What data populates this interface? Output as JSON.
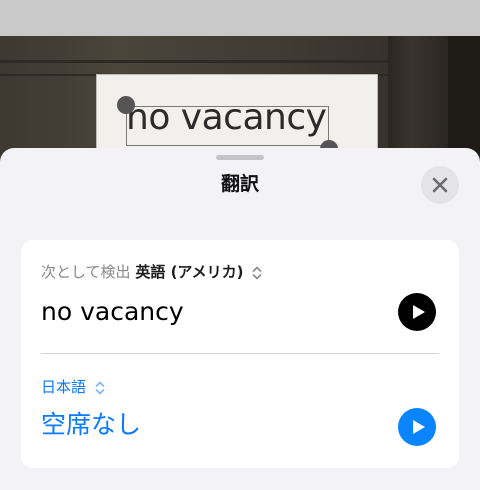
{
  "camera": {
    "detected_text": "no vacancy"
  },
  "sheet": {
    "title": "翻訳",
    "close_icon": "close-icon"
  },
  "source": {
    "prefix": "次として検出",
    "language": "英語 (アメリカ)",
    "text": "no vacancy",
    "play_icon": "play-icon"
  },
  "target": {
    "language": "日本語",
    "text": "空席なし",
    "play_icon": "play-icon"
  },
  "colors": {
    "accent": "#0a84ff",
    "sheet_bg": "#f2f2f7",
    "card_bg": "#ffffff"
  }
}
